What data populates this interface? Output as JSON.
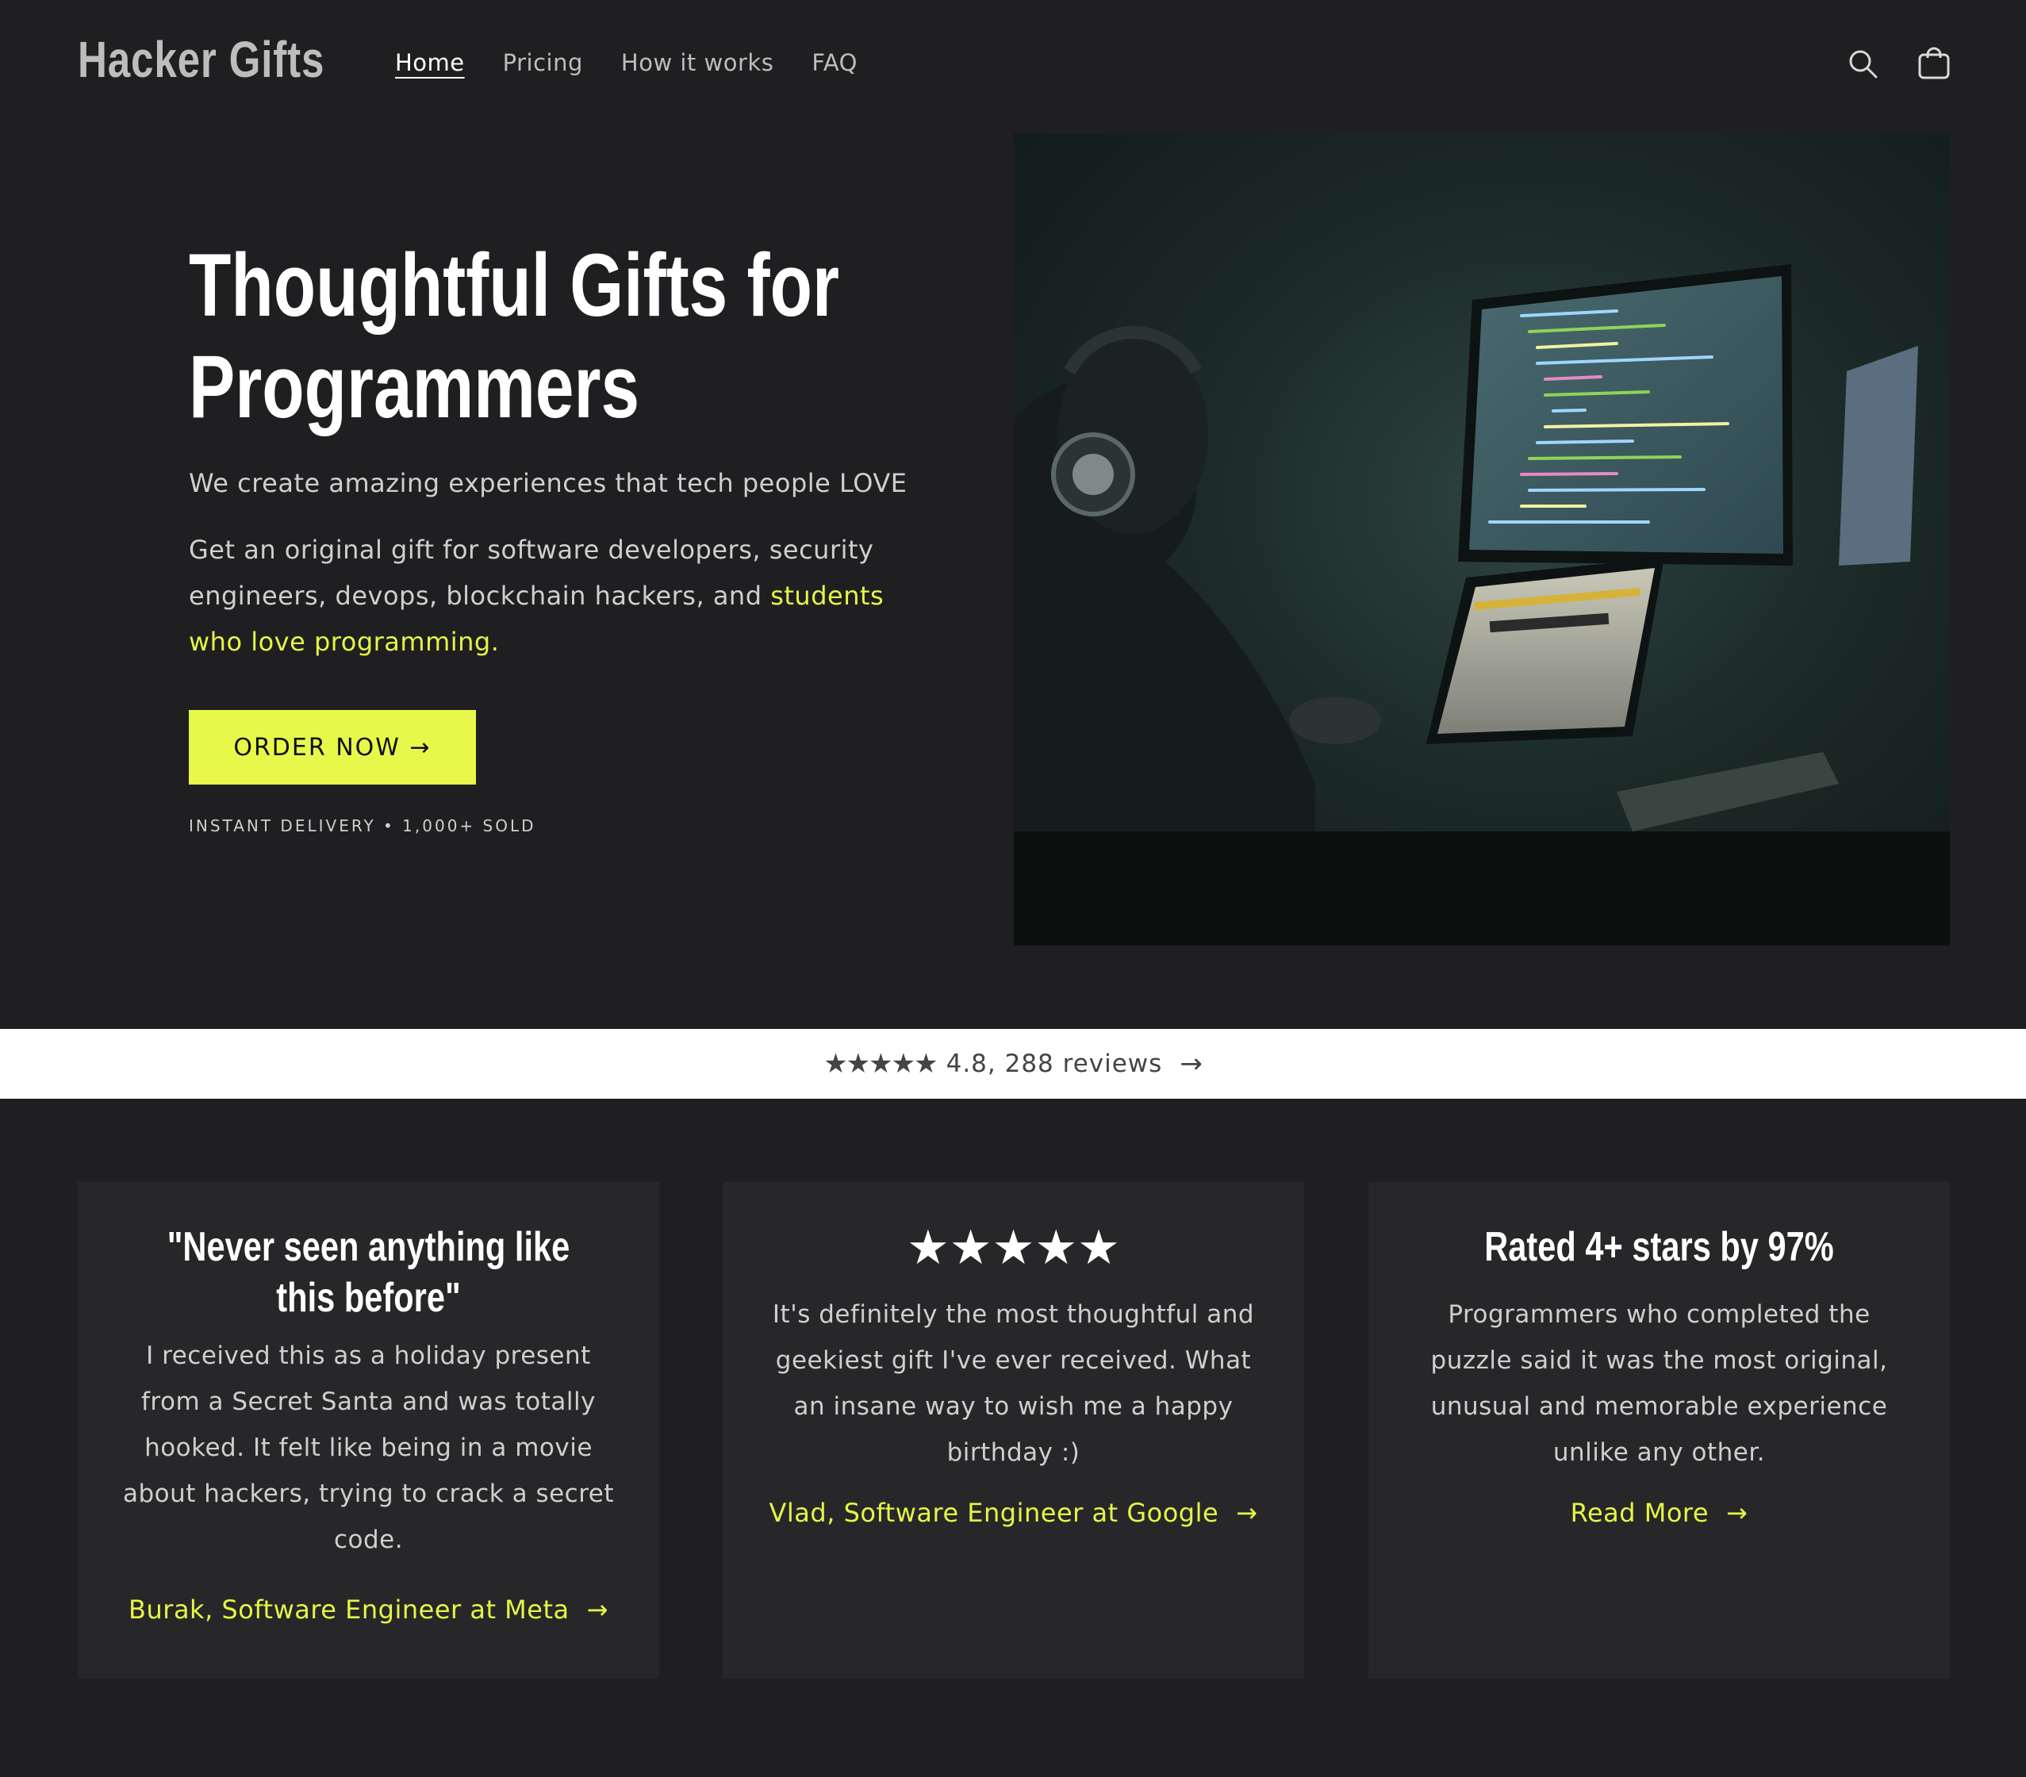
{
  "header": {
    "logo": "Hacker Gifts",
    "nav": [
      {
        "label": "Home",
        "active": true
      },
      {
        "label": "Pricing",
        "active": false
      },
      {
        "label": "How it works",
        "active": false
      },
      {
        "label": "FAQ",
        "active": false
      }
    ],
    "icons": {
      "search": "search-icon",
      "cart": "cart-icon"
    }
  },
  "hero": {
    "title": "Thoughtful Gifts for\nProgrammers",
    "subtitle": "We create amazing experiences that tech people LOVE",
    "desc_prefix": "Get an original gift for software developers, security engineers, devops, blockchain hackers, and ",
    "desc_highlight": "students who love programming",
    "desc_suffix": ".",
    "cta_label": "ORDER NOW →",
    "meta": "INSTANT DELIVERY • 1,000+ SOLD",
    "image": "person-with-headphones-coding-photo"
  },
  "reviews_bar": {
    "stars": "★★★★★",
    "text": "4.8, 288 reviews",
    "arrow": "→"
  },
  "cards": [
    {
      "title": "\"Never seen anything like this before\"",
      "body": "I received this as a holiday present from a Secret Santa and was totally hooked. It felt like being in a movie about hackers, trying to crack a secret code.",
      "link": "Burak, Software Engineer at Meta",
      "arrow": "→"
    },
    {
      "stars": "★★★★★",
      "body": "It's definitely the most thoughtful and geekiest gift I've ever received. What an insane way to wish me a happy birthday :)",
      "link": "Vlad, Software Engineer at Google",
      "arrow": "→"
    },
    {
      "title": "Rated 4+ stars by 97%",
      "body": "Programmers who completed the puzzle said it was the most original, unusual and memorable experience unlike any other.",
      "link": "Read More",
      "arrow": "→"
    }
  ],
  "colors": {
    "background": "#1f1f21",
    "card": "#27272a",
    "accent": "#e7f84a",
    "text": "#cfcfcf"
  }
}
